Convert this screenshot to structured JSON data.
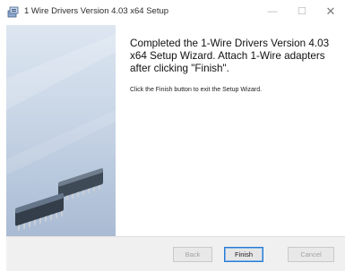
{
  "window": {
    "title": "1 Wire Drivers Version 4.03 x64 Setup",
    "controls": {
      "minimize": "—",
      "maximize": "☐",
      "close": "✕"
    }
  },
  "icons": {
    "app": "installer-package-icon",
    "side_art": "ic-chips-illustration"
  },
  "content": {
    "heading": "Completed the 1-Wire Drivers Version 4.03 x64 Setup Wizard.  Attach 1-Wire adapters after clicking \"Finish\".",
    "instruction": "Click the Finish button to exit the Setup Wizard."
  },
  "buttons": {
    "back": "Back",
    "finish": "Finish",
    "cancel": "Cancel"
  },
  "colors": {
    "accent_border": "#2a7ad2",
    "side_panel_top": "#dde6f1",
    "side_panel_bottom": "#a9bbd3"
  }
}
